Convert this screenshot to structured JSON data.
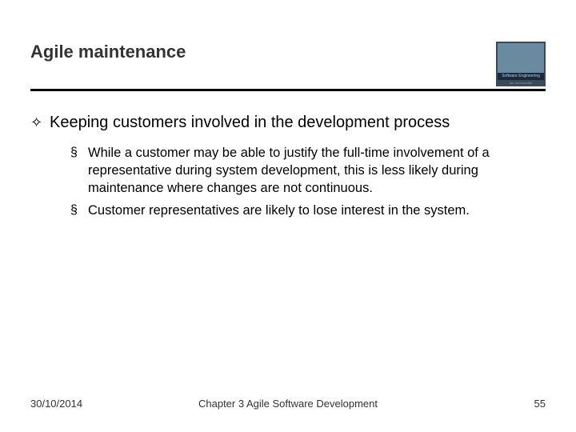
{
  "header": {
    "title": "Agile maintenance",
    "logo_label": "Software Engineering",
    "logo_author": "Ian Sommerville"
  },
  "body": {
    "lvl1_bullet": "✧",
    "lvl1_text": "Keeping customers involved in the development process",
    "lvl2_bullet": "§",
    "items": [
      "While a customer may be able to justify the full-time involvement of a representative during system development, this is less likely during maintenance where changes are not continuous.",
      "Customer representatives are likely to lose interest in the system."
    ]
  },
  "footer": {
    "date": "30/10/2014",
    "chapter": "Chapter 3 Agile Software Development",
    "page": "55"
  }
}
